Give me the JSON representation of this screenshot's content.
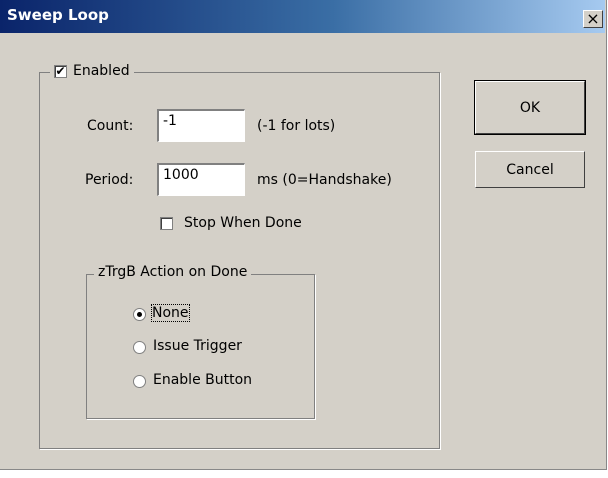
{
  "window": {
    "title": "Sweep Loop",
    "close_glyph": "×"
  },
  "enabled_group": {
    "label": "Enabled",
    "checked": true
  },
  "count": {
    "label": "Count:",
    "value": "-1",
    "hint": "(-1 for lots)"
  },
  "period": {
    "label": "Period:",
    "value": "1000",
    "hint": "ms (0=Handshake)"
  },
  "stop_when_done": {
    "label": "Stop When Done",
    "checked": false
  },
  "ztrgb_group": {
    "label": "zTrgB Action on Done",
    "options": [
      {
        "label": "None",
        "selected": true
      },
      {
        "label": "Issue Trigger",
        "selected": false
      },
      {
        "label": "Enable Button",
        "selected": false
      }
    ]
  },
  "buttons": {
    "ok": "OK",
    "cancel": "Cancel"
  }
}
